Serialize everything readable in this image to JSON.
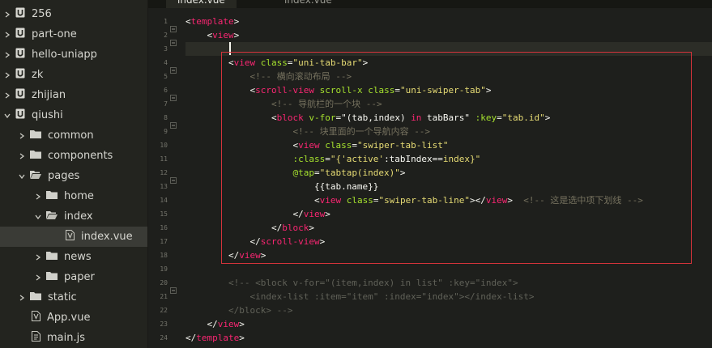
{
  "sidebar": {
    "items": [
      {
        "label": "256",
        "type": "project",
        "expanded": false
      },
      {
        "label": "part-one",
        "type": "project",
        "expanded": false
      },
      {
        "label": "hello-uniapp",
        "type": "project",
        "expanded": false
      },
      {
        "label": "zk",
        "type": "project",
        "expanded": false
      },
      {
        "label": "zhijian",
        "type": "project",
        "expanded": false
      },
      {
        "label": "qiushi",
        "type": "project",
        "expanded": true
      },
      {
        "label": "common",
        "type": "folder",
        "expanded": false
      },
      {
        "label": "components",
        "type": "folder",
        "expanded": false
      },
      {
        "label": "pages",
        "type": "folder",
        "expanded": true
      },
      {
        "label": "home",
        "type": "folder",
        "expanded": false
      },
      {
        "label": "index",
        "type": "folder",
        "expanded": true
      },
      {
        "label": "index.vue",
        "type": "file-vue",
        "selected": true
      },
      {
        "label": "news",
        "type": "folder",
        "expanded": false
      },
      {
        "label": "paper",
        "type": "folder",
        "expanded": false
      },
      {
        "label": "static",
        "type": "folder",
        "expanded": false
      },
      {
        "label": "App.vue",
        "type": "file-vue"
      },
      {
        "label": "main.js",
        "type": "file-js"
      }
    ]
  },
  "tabs": [
    {
      "label": "index.vue",
      "active": true
    },
    {
      "label": "index.vue",
      "active": false
    }
  ],
  "editor": {
    "line_numbers": [
      "1",
      "2",
      "3",
      "4",
      "5",
      "6",
      "7",
      "8",
      "9",
      "10",
      "11",
      "12",
      "13",
      "14",
      "15",
      "16",
      "17",
      "18",
      "19",
      "20",
      "21",
      "22",
      "23",
      "24"
    ],
    "lines": {
      "l1": {
        "t1": "<",
        "t2": "template",
        "t3": ">"
      },
      "l2": {
        "t1": "<",
        "t2": "view",
        "t3": ">"
      },
      "l4": {
        "t1": "<",
        "t2": "view",
        "t3": " ",
        "t4": "class",
        "t5": "=",
        "t6": "\"uni-tab-bar\"",
        "t7": ">"
      },
      "l5": {
        "t1": "<!-- 横向滚动布局 -->"
      },
      "l6": {
        "t1": "<",
        "t2": "scroll-view",
        "t3": " ",
        "t4": "scroll-x",
        "t5": " ",
        "t6": "class",
        "t7": "=",
        "t8": "\"uni-swiper-tab\"",
        "t9": ">"
      },
      "l7": {
        "t1": "<!-- 导航栏的一个块 -->"
      },
      "l8": {
        "t1": "<",
        "t2": "block",
        "t3": " ",
        "t4": "v-for",
        "t5": "=",
        "t6": "\"(tab,index) ",
        "t7": "in",
        "t8": " tabBars\"",
        "t9": " ",
        "t10": ":key",
        "t11": "=",
        "t12": "\"tab.id\"",
        "t13": ">"
      },
      "l9": {
        "t1": "<!-- 块里面的一个导航内容 -->"
      },
      "l10": {
        "t1": "<",
        "t2": "view",
        "t3": " ",
        "t4": "class",
        "t5": "=",
        "t6": "\"swiper-tab-list\""
      },
      "l11": {
        "t1": ":class",
        "t2": "=",
        "t3": "\"{'active'",
        "t4": ":tabIndex==",
        "t5": "index}\""
      },
      "l12": {
        "t1": "@tap",
        "t2": "=",
        "t3": "\"tabtap(index)\"",
        "t4": ">"
      },
      "l13": {
        "t1": "{{tab.name}}"
      },
      "l14": {
        "t1": "<",
        "t2": "view",
        "t3": " ",
        "t4": "class",
        "t5": "=",
        "t6": "\"swiper-tab-line\"",
        "t7": "></",
        "t8": "view",
        "t9": ">",
        "t10": "  <!-- 这是选中项下划线 -->"
      },
      "l15": {
        "t1": "</",
        "t2": "view",
        "t3": ">"
      },
      "l16": {
        "t1": "</",
        "t2": "block",
        "t3": ">"
      },
      "l17": {
        "t1": "</",
        "t2": "scroll-view",
        "t3": ">"
      },
      "l18": {
        "t1": "</",
        "t2": "view",
        "t3": ">"
      },
      "l20": {
        "t1": "<!-- <block v-for=\"(item,index) in list\" :key=\"index\">"
      },
      "l21": {
        "t1": "<index-list :item=\"item\" :index=\"index\"></index-list>"
      },
      "l22": {
        "t1": "</block> -->"
      },
      "l23": {
        "t1": "</",
        "t2": "view",
        "t3": ">"
      },
      "l24": {
        "t1": "</",
        "t2": "template",
        "t3": ">"
      }
    }
  },
  "colors": {
    "highlight_box": "#d4333b",
    "tag": "#f92672",
    "attr": "#a6e22e",
    "string": "#e6db74",
    "comment": "#75715e"
  }
}
